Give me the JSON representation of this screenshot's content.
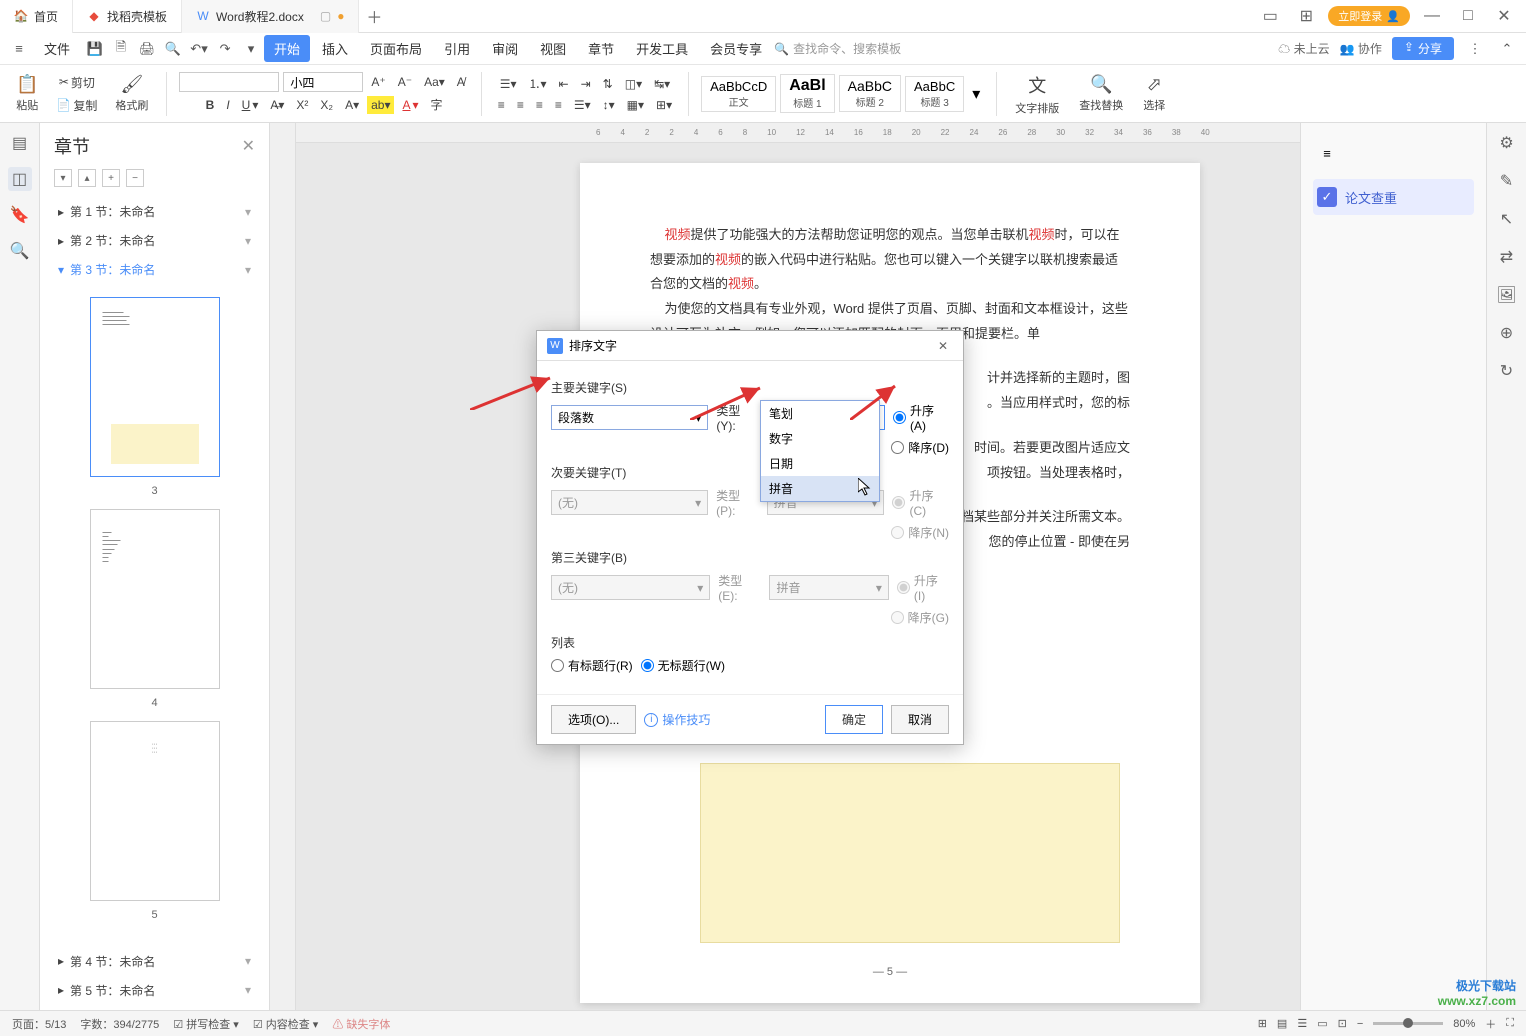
{
  "titlebar": {
    "tabs": [
      {
        "label": "首页",
        "icon": "home"
      },
      {
        "label": "找稻壳模板",
        "icon": "template"
      },
      {
        "label": "Word教程2.docx",
        "icon": "word"
      }
    ],
    "login": "立即登录"
  },
  "menubar": {
    "file": "文件",
    "items": [
      "开始",
      "插入",
      "页面布局",
      "引用",
      "审阅",
      "视图",
      "章节",
      "开发工具",
      "会员专享"
    ],
    "active": 0,
    "search_placeholder": "查找命令、搜索模板",
    "cloud": "未上云",
    "collab": "协作",
    "share": "分享"
  },
  "ribbon": {
    "paste": "粘贴",
    "cut": "剪切",
    "copy": "复制",
    "format": "格式刷",
    "font_name": "",
    "font_size": "小四",
    "styles": [
      {
        "preview": "AaBbCcD",
        "name": "正文"
      },
      {
        "preview": "AaBl",
        "name": "标题 1"
      },
      {
        "preview": "AaBbC",
        "name": "标题 2"
      },
      {
        "preview": "AaBbC",
        "name": "标题 3"
      }
    ],
    "text_layout": "文字排版",
    "find_replace": "查找替换",
    "select": "选择"
  },
  "sidepanel": {
    "title": "章节",
    "sections": [
      "第 1 节：未命名",
      "第 2 节：未命名",
      "第 3 节：未命名",
      "第 4 节：未命名",
      "第 5 节：未命名"
    ],
    "active_section": 2,
    "thumb_numbers": [
      "3",
      "4",
      "5"
    ]
  },
  "document": {
    "p1_a": "视频",
    "p1_b": "提供了功能强大的方法帮助您证明您的观点。当您单击联机",
    "p1_c": "视频",
    "p1_d": "时，可以在想要添加的",
    "p1_e": "视频",
    "p1_f": "的嵌入代码中进行粘贴。您也可以键入一个关键字以联机搜索最适合您的文档的",
    "p1_g": "视频",
    "p1_h": "。",
    "p2": "为使您的文档具有专业外观，Word 提供了页眉、页脚、封面和文本框设计，这些设计可互为补充。例如，您可以添加匹配的封面、页眉和提要栏。单",
    "p3_tail1": "计并选择新的主题时，图",
    "p3_tail2": "。当应用样式时，您的标",
    "p4_tail1": "时间。若要更改图片适应文",
    "p4_tail2": "项按钮。当处理表格时，",
    "p5_tail1": "档某些部分并关注所需文本。",
    "p5_tail2": "您的停止位置 - 即使在另",
    "page_number": "— 5 —"
  },
  "dialog": {
    "title": "排序文字",
    "sections": {
      "primary": "主要关键字(S)",
      "secondary": "次要关键字(T)",
      "third": "第三关键字(B)",
      "list": "列表"
    },
    "key1": {
      "value": "段落数",
      "type_label": "类型(Y):",
      "type_value": "拼音",
      "asc": "升序(A)",
      "desc": "降序(D)"
    },
    "key2": {
      "value": "(无)",
      "type_label": "类型(P):",
      "type_value": "拼音",
      "asc": "升序(C)",
      "desc": "降序(N)"
    },
    "key3": {
      "value": "(无)",
      "type_label": "类型(E):",
      "type_value": "拼音",
      "asc": "升序(I)",
      "desc": "降序(G)"
    },
    "list_radio": {
      "header": "有标题行(R)",
      "noheader": "无标题行(W)"
    },
    "dropdown_options": [
      "笔划",
      "数字",
      "日期",
      "拼音"
    ],
    "buttons": {
      "options": "选项(O)...",
      "tips": "操作技巧",
      "ok": "确定",
      "cancel": "取消"
    }
  },
  "rightpanel": {
    "thesis": "论文查重"
  },
  "statusbar": {
    "page": "页面：5/13",
    "words": "字数：394/2775",
    "spell": "拼写检查",
    "content": "内容检查",
    "missing_font": "缺失字体",
    "zoom": "80%"
  },
  "watermark": {
    "line1": "极光下载站",
    "line2": "www.xz7.com"
  },
  "ruler_marks": [
    "6",
    "4",
    "2",
    "",
    "2",
    "4",
    "6",
    "8",
    "10",
    "12",
    "14",
    "16",
    "18",
    "20",
    "22",
    "24",
    "26",
    "28",
    "30",
    "32",
    "34",
    "36",
    "38",
    "40"
  ]
}
